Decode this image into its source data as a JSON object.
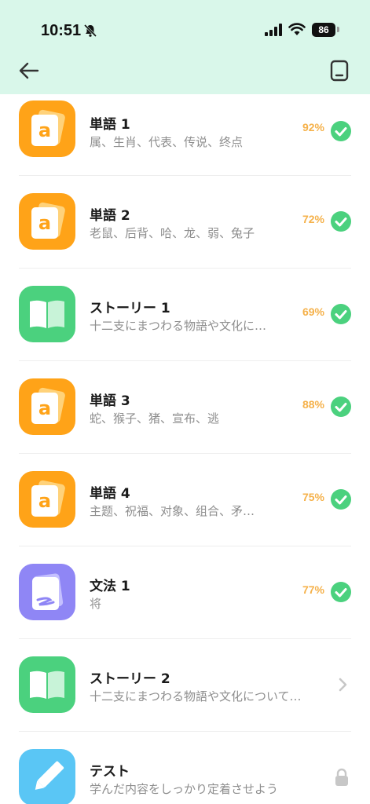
{
  "status_bar": {
    "time": "10:51",
    "battery": "86"
  },
  "header": {
    "back_icon": "arrow-left-icon",
    "notes_icon": "note-icon"
  },
  "colors": {
    "header_bg": "#d9f7ea",
    "accent_green": "#4bd17e",
    "percent_orange": "#f5b14a",
    "tile_orange": "#ffa318",
    "tile_purple": "#8f86f5",
    "tile_blue": "#5ac6f5"
  },
  "lessons": [
    {
      "title": "単語 1",
      "subtitle": "属、生肖、代表、传说、终点",
      "percent": "92%",
      "type": "vocab",
      "status": "done"
    },
    {
      "title": "単語 2",
      "subtitle": "老鼠、后背、哈、龙、弱、兔子",
      "percent": "72%",
      "type": "vocab",
      "status": "done"
    },
    {
      "title": "ストーリー 1",
      "subtitle": "十二支にまつわる物語や文化に…",
      "percent": "69%",
      "type": "story",
      "status": "done"
    },
    {
      "title": "単語 3",
      "subtitle": "蛇、猴子、猪、宣布、逃",
      "percent": "88%",
      "type": "vocab",
      "status": "done"
    },
    {
      "title": "単語 4",
      "subtitle": "主题、祝福、对象、组合、矛…",
      "percent": "75%",
      "type": "vocab",
      "status": "done"
    },
    {
      "title": "文法 1",
      "subtitle": "将",
      "percent": "77%",
      "type": "grammar",
      "status": "done"
    },
    {
      "title": "ストーリー 2",
      "subtitle": "十二支にまつわる物語や文化について…",
      "percent": "",
      "type": "story",
      "status": "next"
    },
    {
      "title": "テスト",
      "subtitle": "学んだ内容をしっかり定着させよう",
      "percent": "",
      "type": "test",
      "status": "locked"
    }
  ]
}
